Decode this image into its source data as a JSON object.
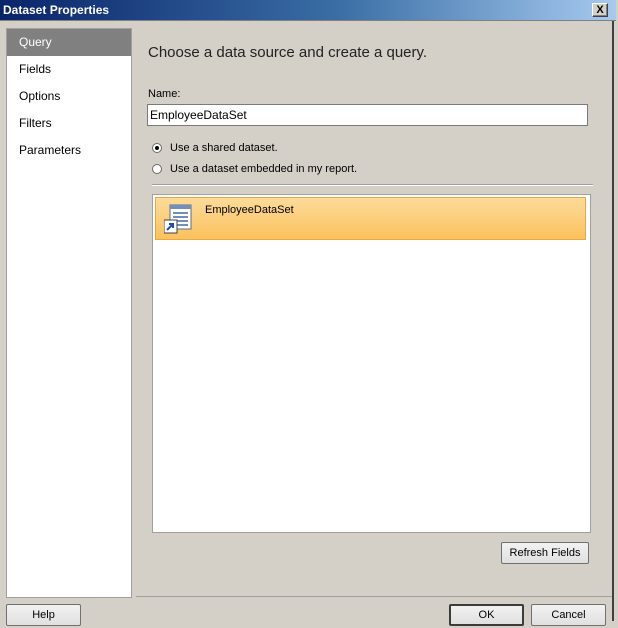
{
  "window": {
    "title": "Dataset Properties",
    "close_label": "X"
  },
  "nav": {
    "items": [
      {
        "label": "Query"
      },
      {
        "label": "Fields"
      },
      {
        "label": "Options"
      },
      {
        "label": "Filters"
      },
      {
        "label": "Parameters"
      }
    ],
    "selected": "Query"
  },
  "main": {
    "heading": "Choose a data source and create a query.",
    "name_label": "Name:",
    "name_value": "EmployeeDataSet",
    "radio_shared": "Use a shared dataset.",
    "radio_embedded": "Use a dataset embedded in my report.",
    "selected_radio": "shared",
    "datasets": [
      {
        "label": "EmployeeDataSet",
        "icon": "shared-dataset-icon"
      }
    ],
    "refresh_label": "Refresh Fields"
  },
  "footer": {
    "help_label": "Help",
    "ok_label": "OK",
    "cancel_label": "Cancel"
  },
  "colors": {
    "title_bar": "#0a246a",
    "selection_highlight": "#fbc15d",
    "nav_selected": "#808080"
  }
}
